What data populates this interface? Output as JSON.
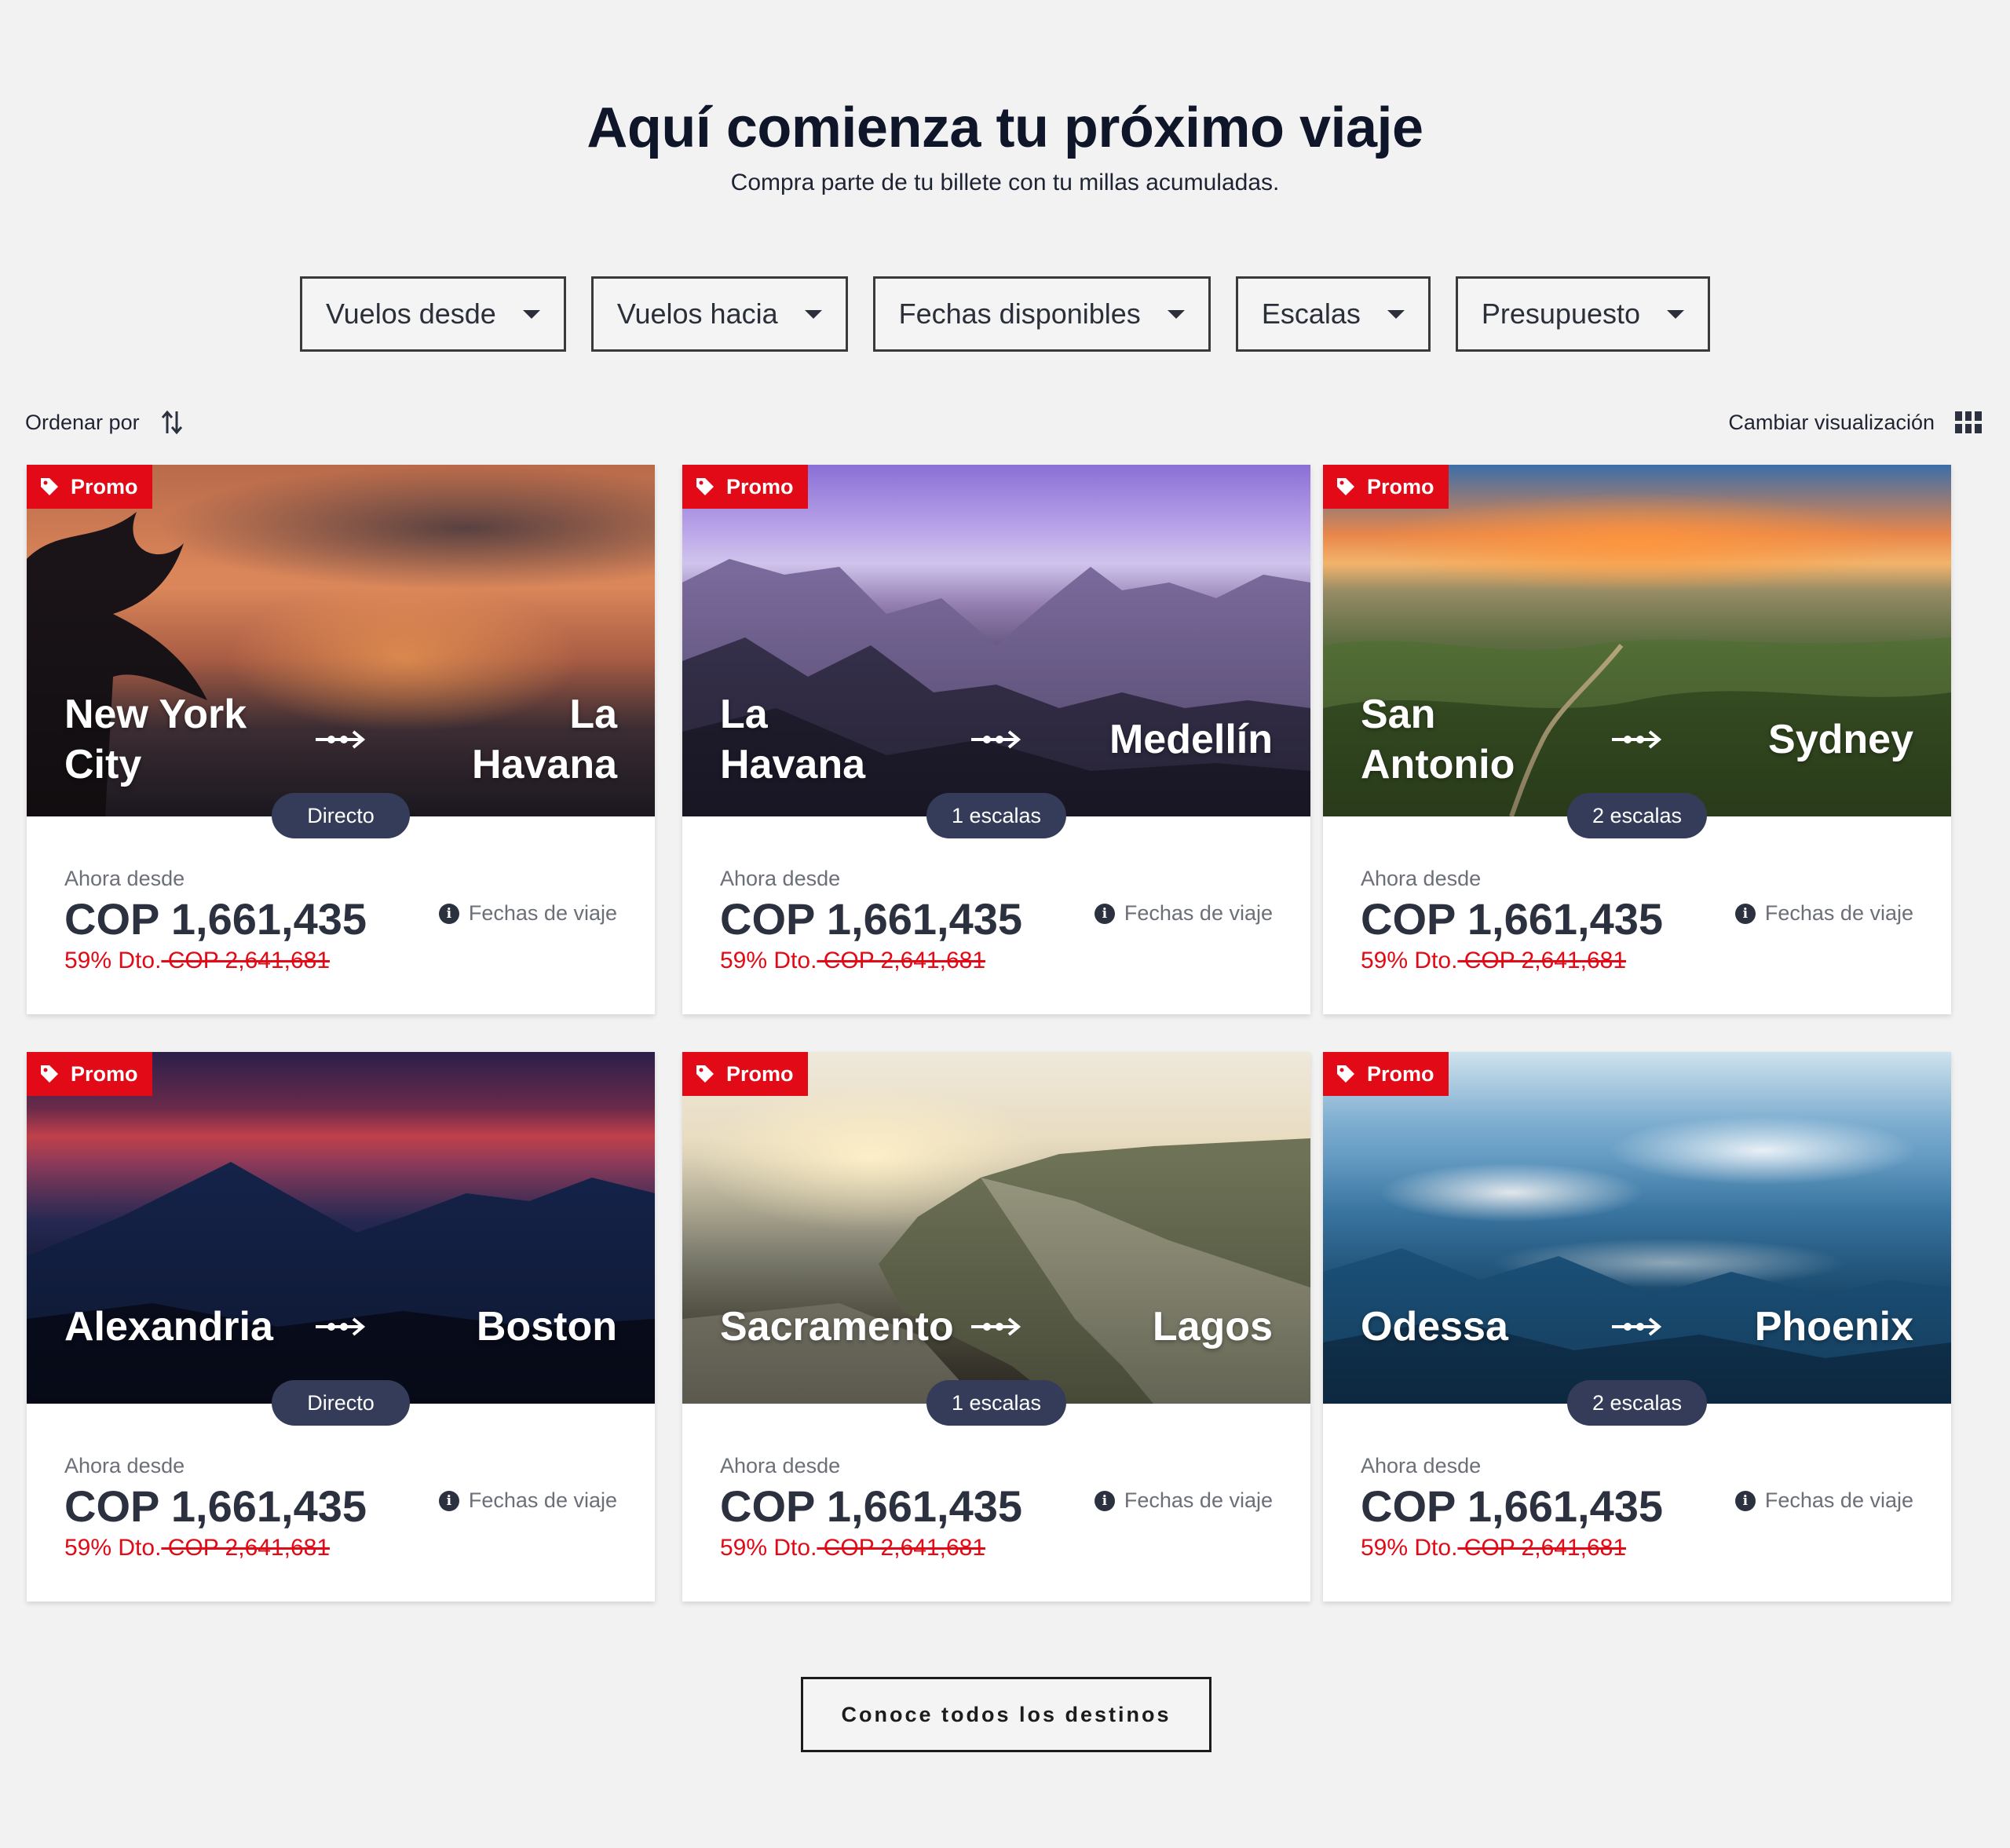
{
  "header": {
    "title": "Aquí comienza tu próximo viaje",
    "subtitle": "Compra parte de tu billete con tu millas acumuladas."
  },
  "filters": [
    {
      "label": "Vuelos desde"
    },
    {
      "label": "Vuelos hacia"
    },
    {
      "label": "Fechas disponibles"
    },
    {
      "label": "Escalas"
    },
    {
      "label": "Presupuesto"
    }
  ],
  "toolbar": {
    "sort_label": "Ordenar por",
    "view_label": "Cambiar visualización"
  },
  "cards": [
    {
      "promo": "Promo",
      "from": "New York City",
      "to": "La Havana",
      "stops": "Directo",
      "from_label": "Ahora desde",
      "price": "COP 1,661,435",
      "discount": "59% Dto.",
      "old_price": " COP 2,641,681",
      "dates_label": "Fechas de viaje"
    },
    {
      "promo": "Promo",
      "from": "La Havana",
      "to": "Medellín",
      "stops": "1 escalas",
      "from_label": "Ahora desde",
      "price": "COP 1,661,435",
      "discount": "59% Dto.",
      "old_price": " COP 2,641,681",
      "dates_label": "Fechas de viaje"
    },
    {
      "promo": "Promo",
      "from": "San Antonio",
      "to": "Sydney",
      "stops": "2 escalas",
      "from_label": "Ahora desde",
      "price": "COP 1,661,435",
      "discount": "59% Dto.",
      "old_price": " COP 2,641,681",
      "dates_label": "Fechas de viaje"
    },
    {
      "promo": "Promo",
      "from": "Alexandria",
      "to": "Boston",
      "stops": "Directo",
      "from_label": "Ahora desde",
      "price": "COP 1,661,435",
      "discount": "59% Dto.",
      "old_price": " COP 2,641,681",
      "dates_label": "Fechas de viaje"
    },
    {
      "promo": "Promo",
      "from": "Sacramento",
      "to": "Lagos",
      "stops": "1 escalas",
      "from_label": "Ahora desde",
      "price": "COP 1,661,435",
      "discount": "59% Dto.",
      "old_price": " COP 2,641,681",
      "dates_label": "Fechas de viaje"
    },
    {
      "promo": "Promo",
      "from": "Odessa",
      "to": "Phoenix",
      "stops": "2 escalas",
      "from_label": "Ahora desde",
      "price": "COP 1,661,435",
      "discount": "59% Dto.",
      "old_price": " COP 2,641,681",
      "dates_label": "Fechas de viaje"
    }
  ],
  "cta": {
    "label": "Conoce todos los destinos"
  },
  "colors": {
    "promo": "#e10a16",
    "badge": "#343c59",
    "price": "#2c3140",
    "discount": "#e10a16"
  }
}
